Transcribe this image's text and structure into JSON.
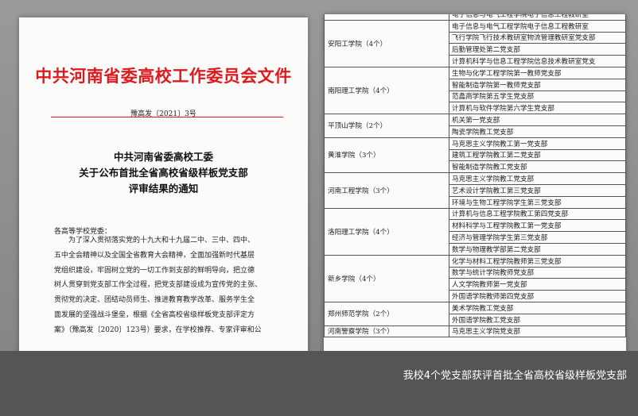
{
  "left_page": {
    "red_title": "中共河南省委高校工作委员会文件",
    "doc_number": "豫高发〔2021〕3号",
    "notice_title_lines": [
      "中共河南省委高校工委",
      "关于公布首批全省高校省级样板党支部",
      "评审结果的通知"
    ],
    "addressee": "各高等学校党委：",
    "body_lines": [
      "为了深入贯彻落实党的十九大和十九届二中、三中、四中、",
      "五中全会精神以及全国全省教育大会精神，全面加强新时代基层",
      "党组织建设，牢固树立党的一切工作到支部的鲜明导向，把立德",
      "树人贯穿到党支部工作全过程，把党支部建设成为宣传党的主张、",
      "贯彻党的决定、团结动员师生、推进教育教学改革、服务学生全",
      "面发展的坚强战斗堡垒，根据《全省高校省级样板党支部评定方",
      "案》（豫高发〔2020〕123号）要求，在学校推荐、专家评审和公"
    ]
  },
  "right_page": {
    "top_partial": "",
    "groups": [
      {
        "school": "",
        "branches": [
          "电子信息与电气工程学院电子信息工程教研室"
        ]
      },
      {
        "school": "安阳工学院（4个）",
        "branches": [
          "电子信息与电气工程学院电子信息工程教研室",
          "飞行学院飞行技术教研室物流管理教研室党支部",
          "后勤管理处第二党支部",
          "计算机科学与信息工程学院信息技术教研室党支"
        ]
      },
      {
        "school": "南阳理工学院（4个）",
        "branches": [
          "生物与化学工程学院第一教师党支部",
          "智能制造学院第一教师党支部",
          "范蠡商学院第五学生党支部",
          "计算机与软件学院第六学生党支部"
        ]
      },
      {
        "school": "平顶山学院（2个）",
        "branches": [
          "机关第一党支部",
          "陶瓷学院教工党支部"
        ]
      },
      {
        "school": "黄淮学院（3个）",
        "branches": [
          "马克思主义学院教工第一党支部",
          "建筑工程学院教工第二党支部",
          "智能制造学院教工党支部"
        ]
      },
      {
        "school": "河南工程学院（3个）",
        "branches": [
          "马克思主义学院教工党支部",
          "艺术设计学院教工第三党支部",
          "环境与生物工程学院学生第三党支部"
        ]
      },
      {
        "school": "洛阳理工学院（4个）",
        "branches": [
          "计算机与信息工程学院教工第四党支部",
          "材料科学与工程学院教工第一党支部",
          "经济与管理学院学生第三党支部",
          "数学与物理教学部第二党支部"
        ]
      },
      {
        "school": "新乡学院（4个）",
        "branches": [
          "化学与材料工程学院教师第三党支部",
          "数学与统计学院教师党支部",
          "人文学院教师第一党支部",
          "外国语学院教师第四党支部"
        ]
      },
      {
        "school": "郑州师范学院（2个）",
        "branches": [
          "美术学院教工党支部",
          "外国语学院教工党支部"
        ]
      },
      {
        "school": "河南警察学院（3个）",
        "branches": [
          "马克思主义学院党支部"
        ]
      }
    ]
  },
  "caption": "我校4个党支部获评首批全省高校省级样板党支部"
}
